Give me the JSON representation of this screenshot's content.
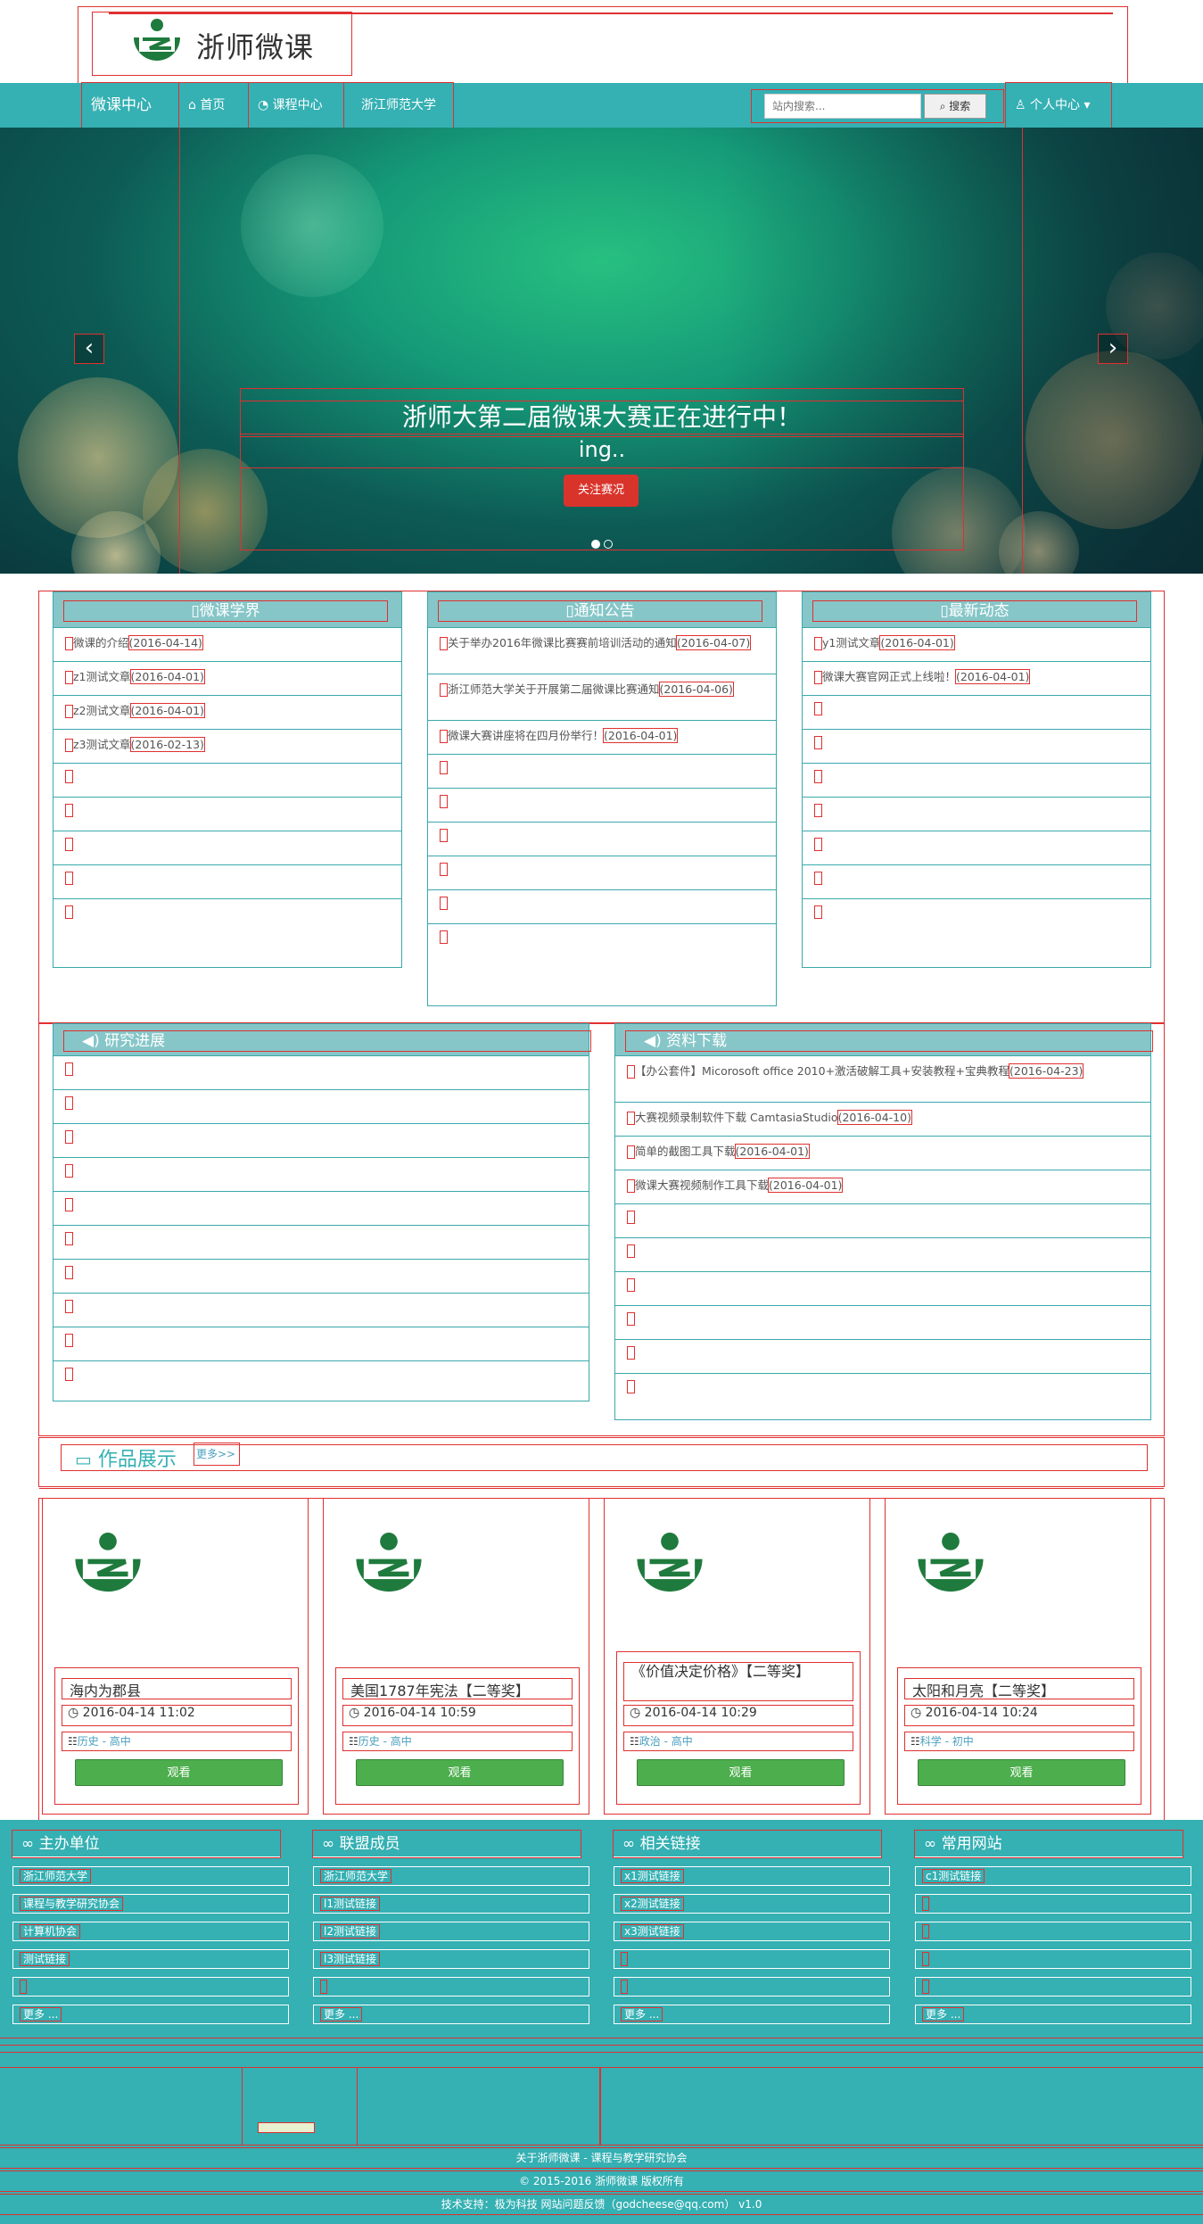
{
  "header": {
    "logo_text": "浙师微课"
  },
  "nav": {
    "brand": "微课中心",
    "items": [
      {
        "label": "首页",
        "icon": "home-icon"
      },
      {
        "label": "课程中心",
        "icon": "dashboard-icon"
      },
      {
        "label": "浙江师范大学",
        "icon": ""
      }
    ],
    "search_placeholder": "站内搜索...",
    "search_button": "搜索",
    "user_menu": "个人中心"
  },
  "banner": {
    "title": "浙师大第二届微课大赛正在进行中！",
    "subtitle": "ing..",
    "button": "关注赛况"
  },
  "panels": {
    "xueshu": {
      "title": "微课学界",
      "items": [
        {
          "text": "微课的介绍",
          "date": "(2016-04-14)"
        },
        {
          "text": "z1测试文章",
          "date": "(2016-04-01)"
        },
        {
          "text": "z2测试文章",
          "date": "(2016-04-01)"
        },
        {
          "text": "z3测试文章",
          "date": "(2016-02-13)"
        }
      ]
    },
    "tongzhi": {
      "title": "通知公告",
      "items": [
        {
          "text": "关于举办2016年微课比赛赛前培训活动的通知",
          "date": "(2016-04-07)"
        },
        {
          "text": "浙江师范大学关于开展第二届微课比赛通知",
          "date": "(2016-04-06)"
        },
        {
          "text": "微课大赛讲座将在四月份举行！",
          "date": "(2016-04-01)"
        }
      ]
    },
    "dongtai": {
      "title": "最新动态",
      "items": [
        {
          "text": "y1测试文章",
          "date": "(2016-04-01)"
        },
        {
          "text": "微课大赛官网正式上线啦！",
          "date": "(2016-04-01)"
        }
      ]
    },
    "yanjiu": {
      "title": "研究进展"
    },
    "xiazai": {
      "title": "资料下载",
      "items": [
        {
          "text": "【办公套件】Micorosoft office 2010+激活破解工具+安装教程+宝典教程",
          "date": "(2016-04-23)"
        },
        {
          "text": "大赛视频录制软件下载 CamtasiaStudio",
          "date": "(2016-04-10)"
        },
        {
          "text": "简单的截图工具下载",
          "date": "(2016-04-01)"
        },
        {
          "text": "微课大赛视频制作工具下载",
          "date": "(2016-04-01)"
        }
      ]
    }
  },
  "works": {
    "title": "作品展示",
    "more": "更多>>",
    "watch": "观看",
    "items": [
      {
        "title": "海内为郡县",
        "date": "2016-04-14 11:02",
        "cat1": "历史",
        "cat2": "高中"
      },
      {
        "title": "美国1787年宪法【二等奖】",
        "date": "2016-04-14 10:59",
        "cat1": "历史",
        "cat2": "高中"
      },
      {
        "title": "《价值决定价格》【二等奖】",
        "date": "2016-04-14 10:29",
        "cat1": "政治",
        "cat2": "高中"
      },
      {
        "title": "太阳和月亮【二等奖】",
        "date": "2016-04-14 10:24",
        "cat1": "科学",
        "cat2": "初中"
      }
    ]
  },
  "footer": {
    "cols": [
      {
        "title": "主办单位",
        "links": [
          "浙江师范大学",
          "课程与教学研究协会",
          "计算机协会",
          "测试链接",
          ""
        ]
      },
      {
        "title": "联盟成员",
        "links": [
          "浙江师范大学",
          "l1测试链接",
          "l2测试链接",
          "l3测试链接",
          ""
        ]
      },
      {
        "title": "相关链接",
        "links": [
          "x1测试链接",
          "x2测试链接",
          "x3测试链接",
          "",
          ""
        ]
      },
      {
        "title": "常用网站",
        "links": [
          "c1测试链接",
          "",
          "",
          "",
          ""
        ]
      }
    ],
    "more": "更多 ...",
    "line1": "关于浙师微课 - 课程与教学研究协会",
    "line2": "© 2015-2016 浙师微课 版权所有",
    "line3": "技术支持：极为科技 网站问题反馈（godcheese@qq.com） v1.0"
  },
  "colors": {
    "teal": "#35b0b3",
    "panel_head": "#86c6c8",
    "green": "#4cae4c",
    "red": "#d9342b",
    "logo_green": "#1f7a3d"
  }
}
